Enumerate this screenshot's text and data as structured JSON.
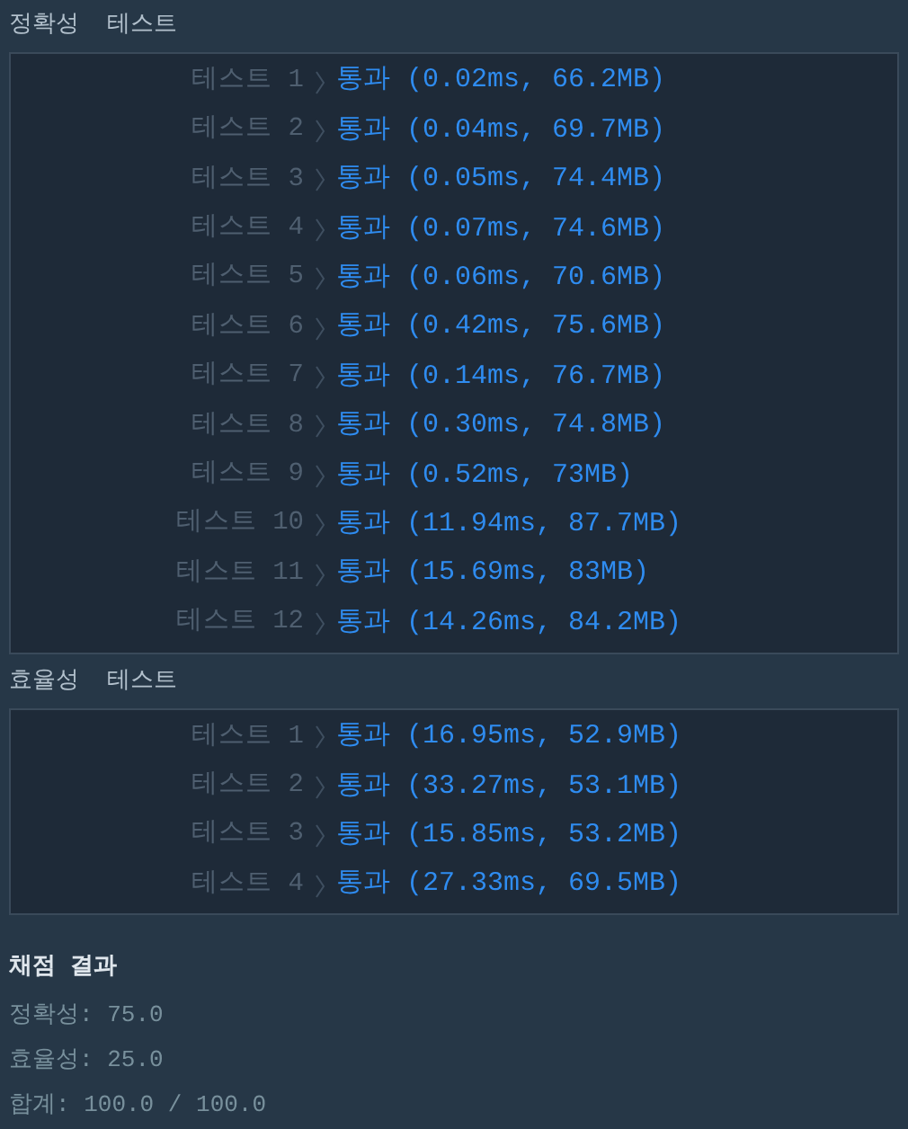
{
  "sections": [
    {
      "title": "정확성  테스트",
      "tests": [
        {
          "label": "테스트 1",
          "result": "통과 (0.02ms, 66.2MB)"
        },
        {
          "label": "테스트 2",
          "result": "통과 (0.04ms, 69.7MB)"
        },
        {
          "label": "테스트 3",
          "result": "통과 (0.05ms, 74.4MB)"
        },
        {
          "label": "테스트 4",
          "result": "통과 (0.07ms, 74.6MB)"
        },
        {
          "label": "테스트 5",
          "result": "통과 (0.06ms, 70.6MB)"
        },
        {
          "label": "테스트 6",
          "result": "통과 (0.42ms, 75.6MB)"
        },
        {
          "label": "테스트 7",
          "result": "통과 (0.14ms, 76.7MB)"
        },
        {
          "label": "테스트 8",
          "result": "통과 (0.30ms, 74.8MB)"
        },
        {
          "label": "테스트 9",
          "result": "통과 (0.52ms, 73MB)"
        },
        {
          "label": "테스트 10",
          "result": "통과 (11.94ms, 87.7MB)"
        },
        {
          "label": "테스트 11",
          "result": "통과 (15.69ms, 83MB)"
        },
        {
          "label": "테스트 12",
          "result": "통과 (14.26ms, 84.2MB)"
        }
      ]
    },
    {
      "title": "효율성  테스트",
      "tests": [
        {
          "label": "테스트 1",
          "result": "통과 (16.95ms, 52.9MB)"
        },
        {
          "label": "테스트 2",
          "result": "통과 (33.27ms, 53.1MB)"
        },
        {
          "label": "테스트 3",
          "result": "통과 (15.85ms, 53.2MB)"
        },
        {
          "label": "테스트 4",
          "result": "통과 (27.33ms, 69.5MB)"
        }
      ]
    }
  ],
  "grading": {
    "title": "채점 결과",
    "lines": [
      "정확성: 75.0",
      "효율성: 25.0",
      "합계: 100.0 / 100.0"
    ]
  }
}
